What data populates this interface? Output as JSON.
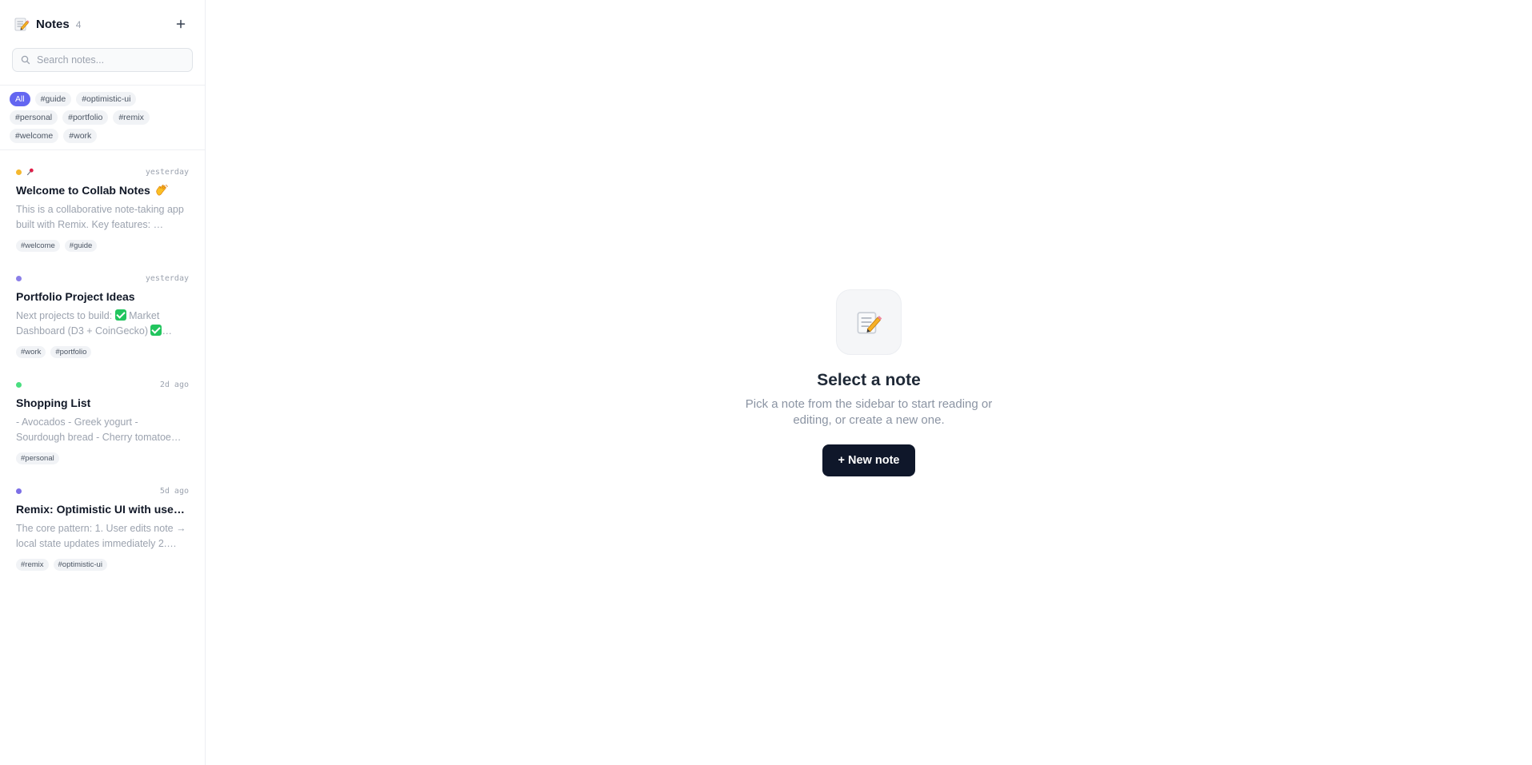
{
  "header": {
    "title": "Notes",
    "count": "4",
    "add_icon": "plus-icon",
    "logo_icon": "memo-icon"
  },
  "search": {
    "placeholder": "Search notes...",
    "value": "",
    "icon": "search-icon"
  },
  "filters": [
    {
      "label": "All",
      "active": true
    },
    {
      "label": "#guide",
      "active": false
    },
    {
      "label": "#optimistic-ui",
      "active": false
    },
    {
      "label": "#personal",
      "active": false
    },
    {
      "label": "#portfolio",
      "active": false
    },
    {
      "label": "#remix",
      "active": false
    },
    {
      "label": "#welcome",
      "active": false
    },
    {
      "label": "#work",
      "active": false
    }
  ],
  "notes": [
    {
      "title": "Welcome to Collab Notes",
      "title_emoji": "waving-hand-icon",
      "pinned": true,
      "dot_color": "#f5b82e",
      "time": "yesterday",
      "preview": "This is a collaborative note-taking app built with Remix. Key features: …",
      "tags": [
        "#welcome",
        "#guide"
      ]
    },
    {
      "title": "Portfolio Project Ideas",
      "pinned": false,
      "dot_color": "#8b7fe8",
      "time": "yesterday",
      "preview_parts": [
        "Next projects to build: ",
        " Market Dashboard (D3 + CoinGecko) ",
        "…"
      ],
      "tags": [
        "#work",
        "#portfolio"
      ]
    },
    {
      "title": "Shopping List",
      "pinned": false,
      "dot_color": "#4ade80",
      "time": "2d ago",
      "preview": "- Avocados - Greek yogurt - Sourdough bread - Cherry tomatoe…",
      "tags": [
        "#personal"
      ]
    },
    {
      "title": "Remix: Optimistic UI with use…",
      "pinned": false,
      "dot_color": "#7c6fe6",
      "time": "5d ago",
      "preview": "The core pattern: 1. User edits note → local state updates immediately 2.…",
      "tags": [
        "#remix",
        "#optimistic-ui"
      ]
    }
  ],
  "empty_state": {
    "icon": "memo-icon",
    "title": "Select a note",
    "subtitle": "Pick a note from the sidebar to start reading or editing, or create a new one.",
    "button_label": "+ New note"
  },
  "colors": {
    "accent": "#6366f1",
    "button_dark": "#0f172a"
  }
}
